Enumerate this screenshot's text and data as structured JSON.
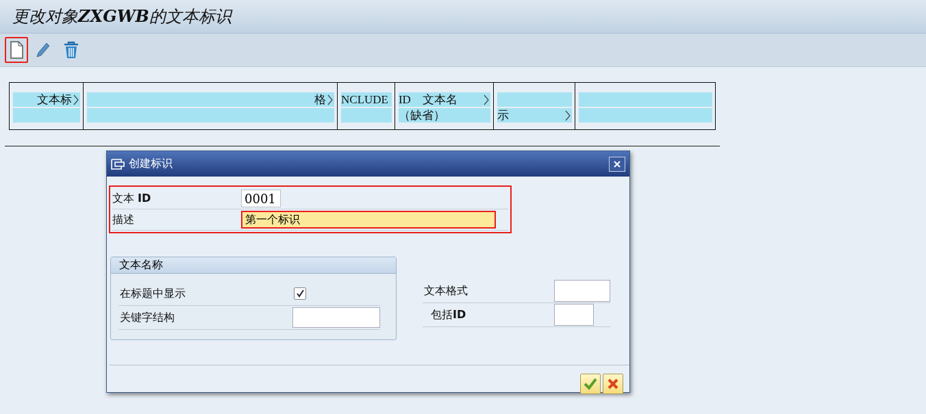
{
  "window": {
    "title": "更改对象**ZXGWB**的文本标识"
  },
  "toolbar": [
    {
      "kind": "create",
      "highlighted": true
    },
    {
      "kind": "edit",
      "highlighted": false
    },
    {
      "kind": "delete",
      "highlighted": false
    }
  ],
  "table": {
    "columns": [
      {
        "cells": [
          {
            "text": "文本标",
            "more": true
          },
          {
            "more": false
          }
        ]
      },
      {
        "cells": [
          {
            "text": "格",
            "more": true
          },
          {
            "more": false
          }
        ]
      },
      {
        "cells": [
          {
            "text": "NCLUDE",
            "more": false
          },
          {
            "more": false
          }
        ]
      },
      {
        "cells": [
          {
            "text": "ID　文本名",
            "more": true
          },
          {
            "text": "（缺省）",
            "more": false
          }
        ]
      },
      {
        "cells": [
          {
            "more": false
          },
          {
            "text": "示",
            "more": true
          }
        ]
      },
      {
        "cells": [
          {
            "more": false
          },
          {
            "more": false
          }
        ]
      }
    ]
  },
  "dialog": {
    "title": "创建标识",
    "fields": [
      {
        "label": "文本 **ID**",
        "value": "0001",
        "kind": "short",
        "required": false
      },
      {
        "label": "描述",
        "value": "第一个标识",
        "kind": "long",
        "required": true
      }
    ],
    "group": {
      "title": "文本名称",
      "rows": [
        {
          "label": "在标题中显示",
          "kind": "checkbox",
          "checked": true
        },
        {
          "label": "关键字结构",
          "kind": "input",
          "value": ""
        }
      ]
    },
    "side_fields": [
      {
        "label": "文本格式"
      },
      {
        "label": "包括**ID**"
      }
    ],
    "buttons": [
      {
        "kind": "confirm"
      },
      {
        "kind": "cancel"
      }
    ]
  }
}
